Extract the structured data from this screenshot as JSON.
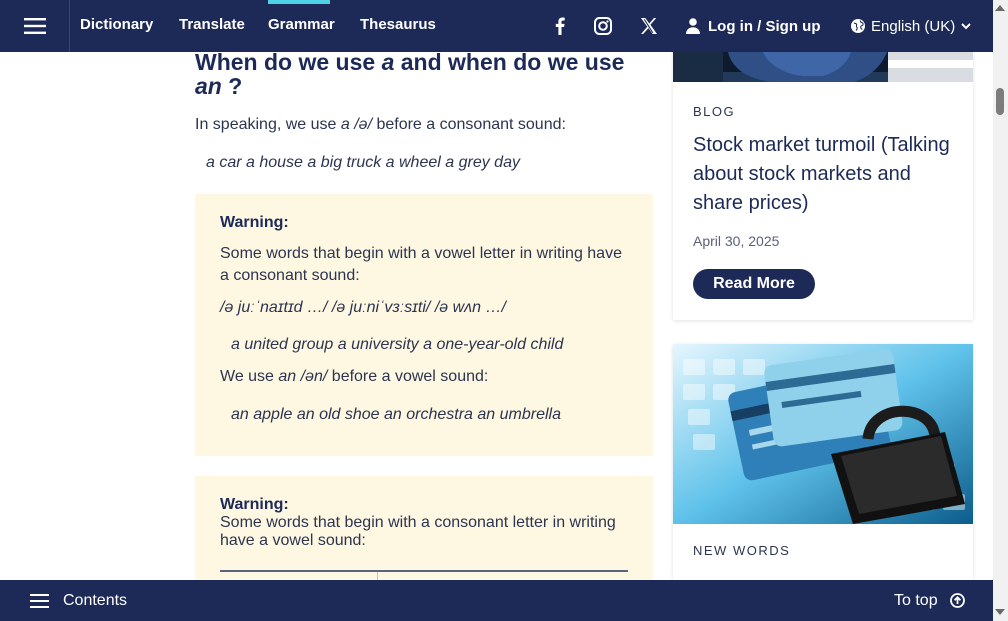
{
  "header": {
    "nav": [
      "Dictionary",
      "Translate",
      "Grammar",
      "Thesaurus"
    ],
    "active_nav": "Grammar",
    "login_label": "Log in / Sign up",
    "language_label": "English (UK)",
    "accent_color": "#4fd1e6",
    "bar_color": "#1d2a57"
  },
  "article": {
    "heading_part1": "When do we use ",
    "heading_a": "a",
    "heading_part2": " and when do we use ",
    "heading_an": "an",
    "heading_end": " ?",
    "intro_text1": "In speaking, we use ",
    "intro_a": "a /ə/",
    "intro_text2": " before a consonant sound:",
    "example1": "a car a house a big truck a wheel a grey day",
    "warning1": {
      "title": "Warning:",
      "text": "Some words that begin with a vowel letter in writing have a consonant sound:",
      "phonetic": "/ə juːˈnaɪtɪd …/ /ə juːniˈvɜːsɪti/ /ə wʌn …/",
      "example": "a united group a university a one-year-old child",
      "an_text1": "We use ",
      "an_form": "an /ən/",
      "an_text2": " before a vowel sound:",
      "an_example": "an apple an old shoe an orchestra an umbrella"
    },
    "warning2": {
      "title": "Warning:",
      "text": "Some words that begin with a consonant letter in writing have a vowel sound:"
    },
    "warning_bg": "#fef7e2"
  },
  "sidebar": {
    "card1": {
      "label": "BLOG",
      "title": "Stock market turmoil (Talking about stock markets and share prices)",
      "date": "April 30, 2025",
      "button": "Read More"
    },
    "card2": {
      "label": "NEW WORDS"
    }
  },
  "footer": {
    "contents_label": "Contents",
    "totop_label": "To top"
  }
}
